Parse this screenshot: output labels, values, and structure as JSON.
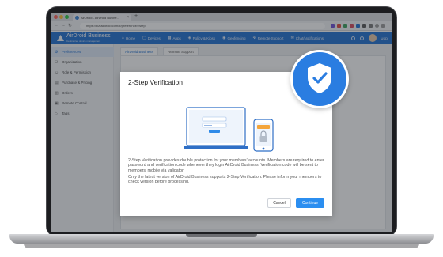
{
  "browser": {
    "tab_title": "AirDroid - AirDroid Busine...",
    "tab_close": "×",
    "new_tab": "+",
    "url": "https://biz.airdroid.com/#/preference/2step"
  },
  "app": {
    "logo_text": "AirDroid Business",
    "logo_sub": "Centralized device management",
    "nav": [
      {
        "icon": "home-icon",
        "glyph": "⌂",
        "label": "Home"
      },
      {
        "icon": "devices-icon",
        "glyph": "▢",
        "label": "Devices"
      },
      {
        "icon": "apps-icon",
        "glyph": "▦",
        "label": "Apps"
      },
      {
        "icon": "policy-icon",
        "glyph": "◈",
        "label": "Policy & Kiosk"
      },
      {
        "icon": "geofencing-icon",
        "glyph": "◉",
        "label": "Geofencing"
      },
      {
        "icon": "remote-support-icon",
        "glyph": "✣",
        "label": "Remote Support"
      },
      {
        "icon": "chat-icon",
        "glyph": "✉",
        "label": "Chat/Notifications"
      }
    ],
    "lang": "USD"
  },
  "sidebar": {
    "items": [
      {
        "label": "Preferences",
        "glyph": "⚙",
        "icon": "gear-icon",
        "active": true
      },
      {
        "label": "Organization",
        "glyph": "⛁",
        "icon": "organization-icon",
        "active": false
      },
      {
        "label": "Role & Permission",
        "glyph": "☺",
        "icon": "role-icon",
        "active": false
      },
      {
        "label": "Purchase & Pricing",
        "glyph": "▤",
        "icon": "purchase-icon",
        "active": false
      },
      {
        "label": "Orders",
        "glyph": "▥",
        "icon": "orders-icon",
        "active": false
      },
      {
        "label": "Remote Control",
        "glyph": "▣",
        "icon": "remote-control-icon",
        "active": false
      },
      {
        "label": "Tags",
        "glyph": "◇",
        "icon": "tag-icon",
        "active": false
      }
    ]
  },
  "content_tabs": [
    "AirDroid Business",
    "Remote Support"
  ],
  "modal": {
    "title": "2-Step Verification",
    "description": "2-Step Verification provides double protection for your members' accounts. Members are required to enter password and verification code whenever they login AirDroid Business. Verification code will be sent to members' mobile via validator.",
    "note": "Only the latest version of AirDroid Business supports 2-Step Verification. Please inform your members to check version before processing.",
    "cancel_label": "Cancel",
    "continue_label": "Continue"
  },
  "colors": {
    "brand": "#1e6fd1",
    "primary_button": "#2b8ef0",
    "shield_badge": "#2a7de1",
    "lock_accent": "#f4a53a"
  },
  "badge": {
    "icon": "shield-check-icon"
  }
}
